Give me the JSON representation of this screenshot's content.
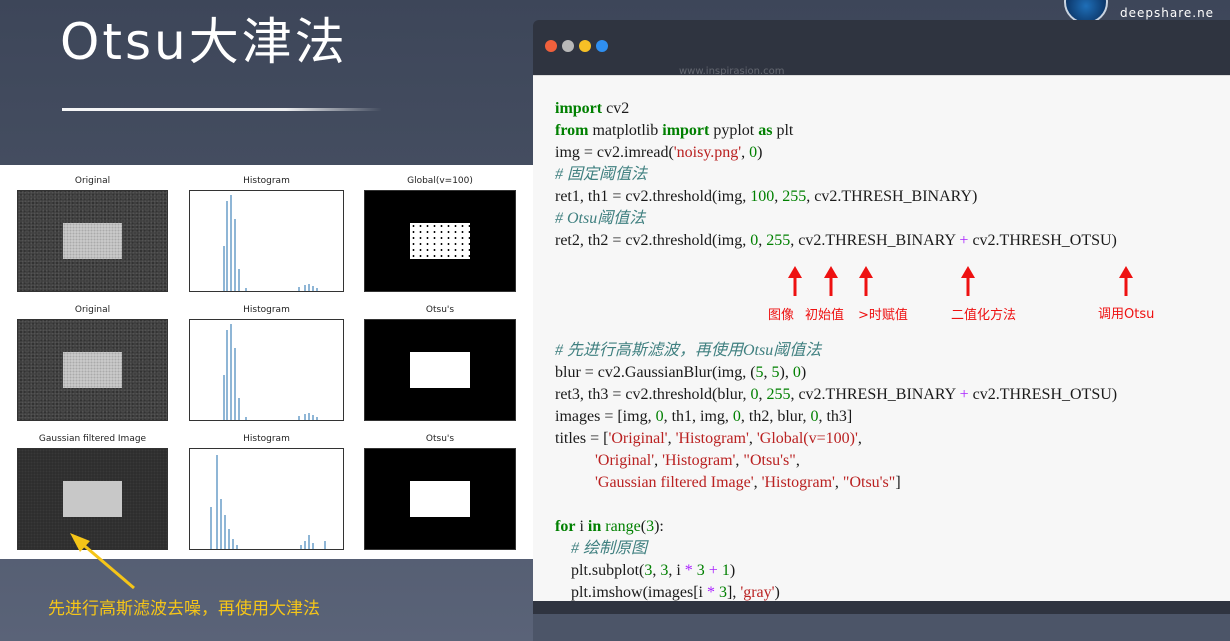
{
  "slide": {
    "title": "Otsu大津法",
    "logo_domain": "deepshare.ne"
  },
  "figure": {
    "titles": [
      "Original",
      "Histogram",
      "Global(v=100)",
      "Original",
      "Histogram",
      "Otsu's",
      "Gaussian filtered Image",
      "Histogram",
      "Otsu's"
    ]
  },
  "annotation": {
    "text": "先进行高斯滤波去噪，再使用大津法",
    "color": "#f5c518"
  },
  "code_window": {
    "watermark": "www.inspirasion.com",
    "dots": [
      "#f0603c",
      "#b8b8b8",
      "#f6c026",
      "#2f8ff0"
    ],
    "lines": [
      [
        {
          "t": "import",
          "c": "kw"
        },
        {
          "t": " cv2"
        }
      ],
      [
        {
          "t": "from",
          "c": "kw"
        },
        {
          "t": " matplotlib "
        },
        {
          "t": "import",
          "c": "kw"
        },
        {
          "t": " pyplot "
        },
        {
          "t": "as",
          "c": "kw"
        },
        {
          "t": " plt"
        }
      ],
      [
        {
          "t": "img = cv2.imread("
        },
        {
          "t": "'noisy.png'",
          "c": "st"
        },
        {
          "t": ", "
        },
        {
          "t": "0",
          "c": "nu"
        },
        {
          "t": ")"
        }
      ],
      [
        {
          "t": "# 固定阈值法",
          "c": "cm"
        }
      ],
      [
        {
          "t": "ret1, th1 = cv2.threshold(img, "
        },
        {
          "t": "100",
          "c": "nu"
        },
        {
          "t": ", "
        },
        {
          "t": "255",
          "c": "nu"
        },
        {
          "t": ", cv2.THRESH_BINARY)"
        }
      ],
      [
        {
          "t": "# Otsu阈值法",
          "c": "cm"
        }
      ],
      [
        {
          "t": "ret2, th2 = cv2.threshold(img, "
        },
        {
          "t": "0",
          "c": "nu"
        },
        {
          "t": ", "
        },
        {
          "t": "255",
          "c": "nu"
        },
        {
          "t": ", cv2.THRESH_BINARY "
        },
        {
          "t": "+",
          "c": "op"
        },
        {
          "t": " cv2.THRESH_OTSU)"
        }
      ],
      [],
      [],
      [],
      [],
      [
        {
          "t": "# 先进行高斯滤波，再使用Otsu阈值法",
          "c": "cm"
        }
      ],
      [
        {
          "t": "blur = cv2.GaussianBlur(img, ("
        },
        {
          "t": "5",
          "c": "nu"
        },
        {
          "t": ", "
        },
        {
          "t": "5",
          "c": "nu"
        },
        {
          "t": "), "
        },
        {
          "t": "0",
          "c": "nu"
        },
        {
          "t": ")"
        }
      ],
      [
        {
          "t": "ret3, th3 = cv2.threshold(blur, "
        },
        {
          "t": "0",
          "c": "nu"
        },
        {
          "t": ", "
        },
        {
          "t": "255",
          "c": "nu"
        },
        {
          "t": ", cv2.THRESH_BINARY "
        },
        {
          "t": "+",
          "c": "op"
        },
        {
          "t": " cv2.THRESH_OTSU)"
        }
      ],
      [
        {
          "t": "images = [img, "
        },
        {
          "t": "0",
          "c": "nu"
        },
        {
          "t": ", th1, img, "
        },
        {
          "t": "0",
          "c": "nu"
        },
        {
          "t": ", th2, blur, "
        },
        {
          "t": "0",
          "c": "nu"
        },
        {
          "t": ", th3]"
        }
      ],
      [
        {
          "t": "titles = ["
        },
        {
          "t": "'Original'",
          "c": "st"
        },
        {
          "t": ", "
        },
        {
          "t": "'Histogram'",
          "c": "st"
        },
        {
          "t": ", "
        },
        {
          "t": "'Global(v=100)'",
          "c": "st"
        },
        {
          "t": ","
        }
      ],
      [
        {
          "t": "          "
        },
        {
          "t": "'Original'",
          "c": "st"
        },
        {
          "t": ", "
        },
        {
          "t": "'Histogram'",
          "c": "st"
        },
        {
          "t": ", "
        },
        {
          "t": "\"Otsu's\"",
          "c": "st"
        },
        {
          "t": ","
        }
      ],
      [
        {
          "t": "          "
        },
        {
          "t": "'Gaussian filtered Image'",
          "c": "st"
        },
        {
          "t": ", "
        },
        {
          "t": "'Histogram'",
          "c": "st"
        },
        {
          "t": ", "
        },
        {
          "t": "\"Otsu's\"",
          "c": "st"
        },
        {
          "t": "]"
        }
      ],
      [],
      [
        {
          "t": "for",
          "c": "kw"
        },
        {
          "t": " i "
        },
        {
          "t": "in",
          "c": "kw"
        },
        {
          "t": " "
        },
        {
          "t": "range",
          "c": "bi"
        },
        {
          "t": "("
        },
        {
          "t": "3",
          "c": "nu"
        },
        {
          "t": "):"
        }
      ],
      [
        {
          "t": "    "
        },
        {
          "t": "# 绘制原图",
          "c": "cm"
        }
      ],
      [
        {
          "t": "    plt.subplot("
        },
        {
          "t": "3",
          "c": "nu"
        },
        {
          "t": ", "
        },
        {
          "t": "3",
          "c": "nu"
        },
        {
          "t": ", i "
        },
        {
          "t": "*",
          "c": "op"
        },
        {
          "t": " "
        },
        {
          "t": "3",
          "c": "nu"
        },
        {
          "t": " "
        },
        {
          "t": "+",
          "c": "op"
        },
        {
          "t": " "
        },
        {
          "t": "1",
          "c": "nu"
        },
        {
          "t": ")"
        }
      ],
      [
        {
          "t": "    plt.imshow(images[i "
        },
        {
          "t": "*",
          "c": "op"
        },
        {
          "t": " "
        },
        {
          "t": "3",
          "c": "nu"
        },
        {
          "t": "], "
        },
        {
          "t": "'gray'",
          "c": "st"
        },
        {
          "t": ")"
        }
      ]
    ],
    "annotations": [
      {
        "label": "图像"
      },
      {
        "label": "初始值"
      },
      {
        "label": ">时赋值"
      },
      {
        "label": "二值化方法"
      },
      {
        "label": "调用Otsu"
      }
    ]
  }
}
